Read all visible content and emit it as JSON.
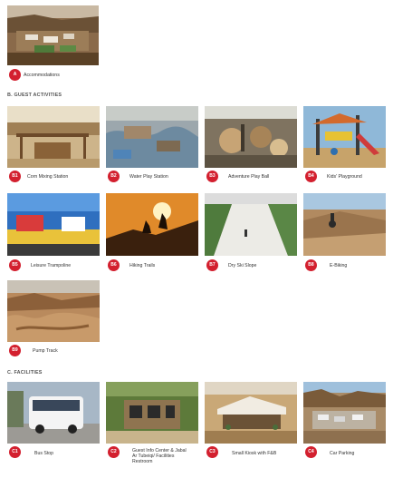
{
  "colors": {
    "badge": "#d3202f",
    "text": "#333333"
  },
  "accommodation": {
    "badge": "A",
    "label": "Accommodations"
  },
  "sections": {
    "guest_activities": "B. GUEST ACTIVITIES",
    "facilities": "C. FACILITIES"
  },
  "activities": [
    {
      "badge": "B1",
      "label": "Corn Mixing Station"
    },
    {
      "badge": "B2",
      "label": "Water Play Station"
    },
    {
      "badge": "B3",
      "label": "Adventure Play Ball"
    },
    {
      "badge": "B4",
      "label": "Kids' Playground"
    },
    {
      "badge": "B5",
      "label": "Leisure Trampoline"
    },
    {
      "badge": "B6",
      "label": "Hiking Trails"
    },
    {
      "badge": "B7",
      "label": "Dry Ski Slope"
    },
    {
      "badge": "B8",
      "label": "E-Biking"
    },
    {
      "badge": "B9",
      "label": "Pump Track"
    }
  ],
  "facilities": [
    {
      "badge": "C1",
      "label": "Bus Stop"
    },
    {
      "badge": "C2",
      "label": "Guest Info Center & Jabal Ar Tubeiqi/ Facilities Restroom"
    },
    {
      "badge": "C3",
      "label": "Small Kiosk with F&B"
    },
    {
      "badge": "C4",
      "label": "Car Parking"
    }
  ]
}
